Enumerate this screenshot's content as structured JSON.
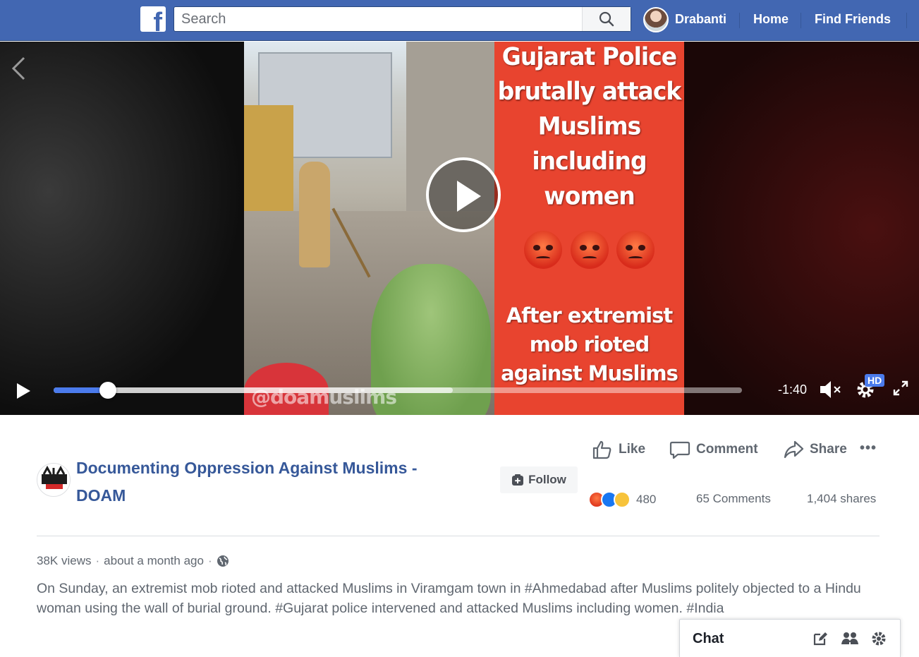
{
  "header": {
    "search_placeholder": "Search",
    "user_name": "Drabanti",
    "nav": [
      "Home",
      "Find Friends"
    ]
  },
  "video": {
    "overlay_headline_lines": [
      "Gujarat Police",
      "brutally attack",
      "Muslims",
      "including",
      "women"
    ],
    "overlay_subline_lines": [
      "After extremist",
      "mob rioted",
      "against Muslims"
    ],
    "watermark": "@doamuslims",
    "time_remaining": "-1:40",
    "quality_badge": "HD",
    "progress_played": 0.079,
    "progress_buffered": 0.58
  },
  "post": {
    "page_name": "Documenting Oppression Against Muslims - DOAM",
    "page_logo_text": "DOAM",
    "follow_label": "Follow",
    "actions": {
      "like": "Like",
      "comment": "Comment",
      "share": "Share"
    },
    "more": "•••",
    "reaction_count": "480",
    "comments": "65 Comments",
    "shares": "1,404 shares",
    "views": "38K views",
    "time": "about a month ago",
    "separator": "·",
    "description": "On Sunday, an extremist mob rioted and attacked Muslims in Viramgam town in #Ahmedabad after Muslims politely objected to a Hindu woman using the wall of burial ground. #Gujarat police intervened and attacked Muslims including women. #India"
  },
  "chat": {
    "title": "Chat"
  },
  "colors": {
    "brand": "#4267b2",
    "link": "#365899",
    "progress": "#4b7bec",
    "overlay": "#e8442f"
  }
}
